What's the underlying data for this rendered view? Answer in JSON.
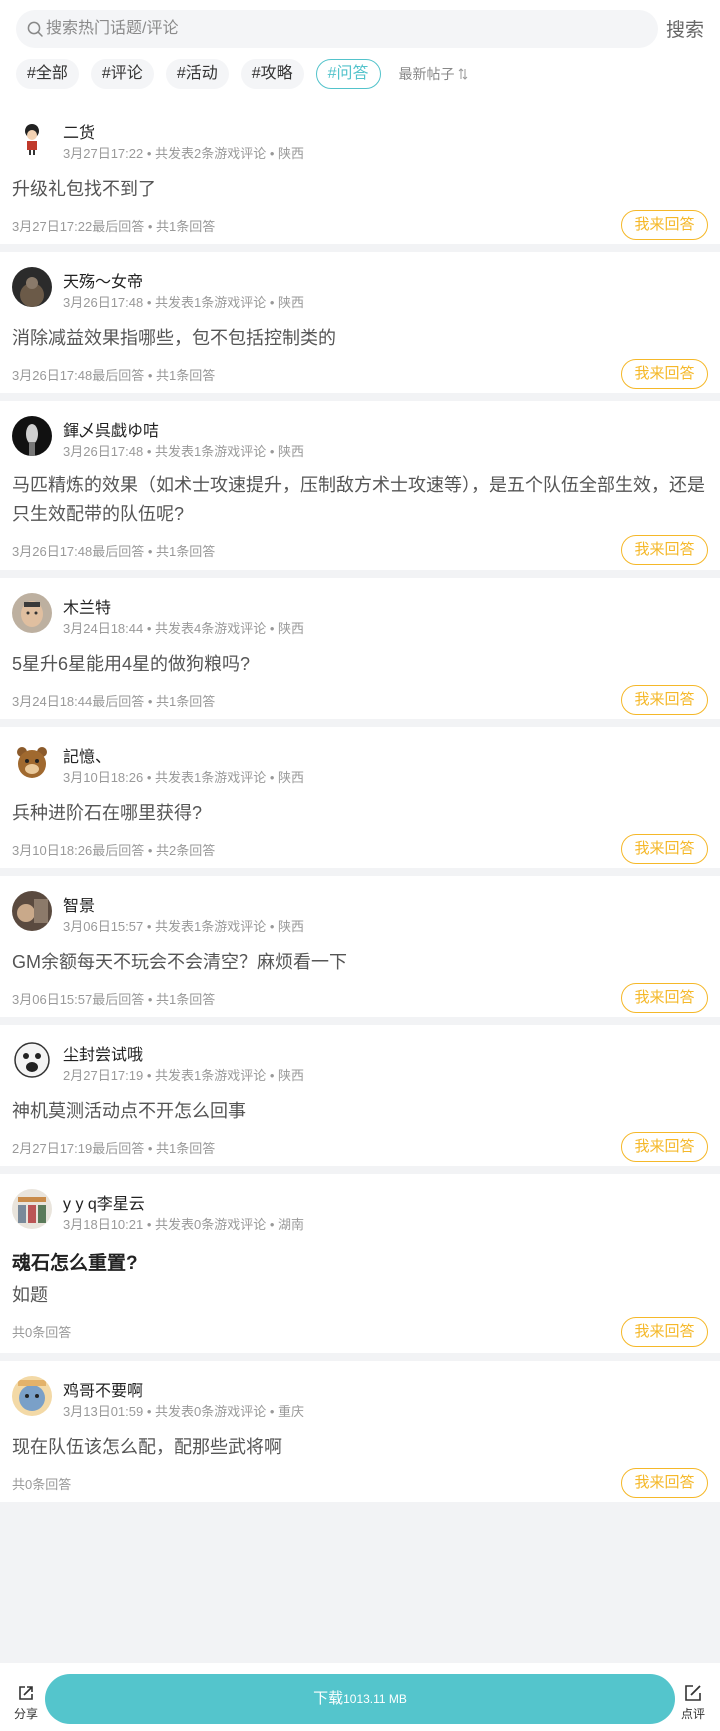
{
  "search": {
    "placeholder": "搜索热门话题/评论",
    "button_label": "搜索"
  },
  "tabs": [
    {
      "label": "#全部",
      "active": false
    },
    {
      "label": "#评论",
      "active": false
    },
    {
      "label": "#活动",
      "active": false
    },
    {
      "label": "#攻略",
      "active": false
    },
    {
      "label": "#问答",
      "active": true
    }
  ],
  "sort": {
    "label": "最新帖子"
  },
  "posts": [
    {
      "user": "二货",
      "meta": "3月27日17:22 • 共发表2条游戏评论 • 陕西",
      "title": "",
      "text": "升级礼包找不到了",
      "footer": "3月27日17:22最后回答 • 共1条回答",
      "button": "我来回答"
    },
    {
      "user": "天殇～女帝",
      "meta": "3月26日17:48 • 共发表1条游戏评论 • 陕西",
      "title": "",
      "text": "消除减益效果指哪些，包不包括控制类的",
      "footer": "3月26日17:48最后回答 • 共1条回答",
      "button": "我来回答"
    },
    {
      "user": "鍕乄呉戱ゆ咭",
      "meta": "3月26日17:48 • 共发表1条游戏评论 • 陕西",
      "title": "",
      "text": "马匹精炼的效果（如术士攻速提升，压制敌方术士攻速等），是五个队伍全部生效，还是只生效配带的队伍呢?",
      "footer": "3月26日17:48最后回答 • 共1条回答",
      "button": "我来回答"
    },
    {
      "user": "木兰特",
      "meta": "3月24日18:44 • 共发表4条游戏评论 • 陕西",
      "title": "",
      "text": "5星升6星能用4星的做狗粮吗?",
      "footer": "3月24日18:44最后回答 • 共1条回答",
      "button": "我来回答"
    },
    {
      "user": "記憶、",
      "meta": "3月10日18:26 • 共发表1条游戏评论 • 陕西",
      "title": "",
      "text": "兵种进阶石在哪里获得?",
      "footer": "3月10日18:26最后回答 • 共2条回答",
      "button": "我来回答"
    },
    {
      "user": "智景",
      "meta": "3月06日15:57 • 共发表1条游戏评论 • 陕西",
      "title": "",
      "text": "GM余额每天不玩会不会清空？麻烦看一下",
      "footer": "3月06日15:57最后回答 • 共1条回答",
      "button": "我来回答"
    },
    {
      "user": "尘封尝试哦",
      "meta": "2月27日17:19 • 共发表1条游戏评论 • 陕西",
      "title": "",
      "text": "神机莫测活动点不开怎么回事",
      "footer": "2月27日17:19最后回答 • 共1条回答",
      "button": "我来回答"
    },
    {
      "user": "y y q李星云",
      "meta": "3月18日10:21 • 共发表0条游戏评论 • 湖南",
      "title": "魂石怎么重置?",
      "text": "如题",
      "footer": "共0条回答",
      "button": "我来回答"
    },
    {
      "user": "鸡哥不要啊",
      "meta": "3月13日01:59 • 共发表0条游戏评论 • 重庆",
      "title": "",
      "text": "现在队伍该怎么配，配那些武将啊",
      "footer": "共0条回答",
      "button": "我来回答"
    }
  ],
  "bottom": {
    "share_label": "分享",
    "download_label": "下载",
    "download_size": "1013.11 MB",
    "review_label": "点评"
  },
  "colors": {
    "accent": "#53c3cb",
    "answer": "#f5b829",
    "download": "#54c5cc"
  },
  "icons": {
    "search": "search-icon",
    "sort": "sort-arrows-icon",
    "share": "share-icon",
    "review": "edit-icon"
  }
}
